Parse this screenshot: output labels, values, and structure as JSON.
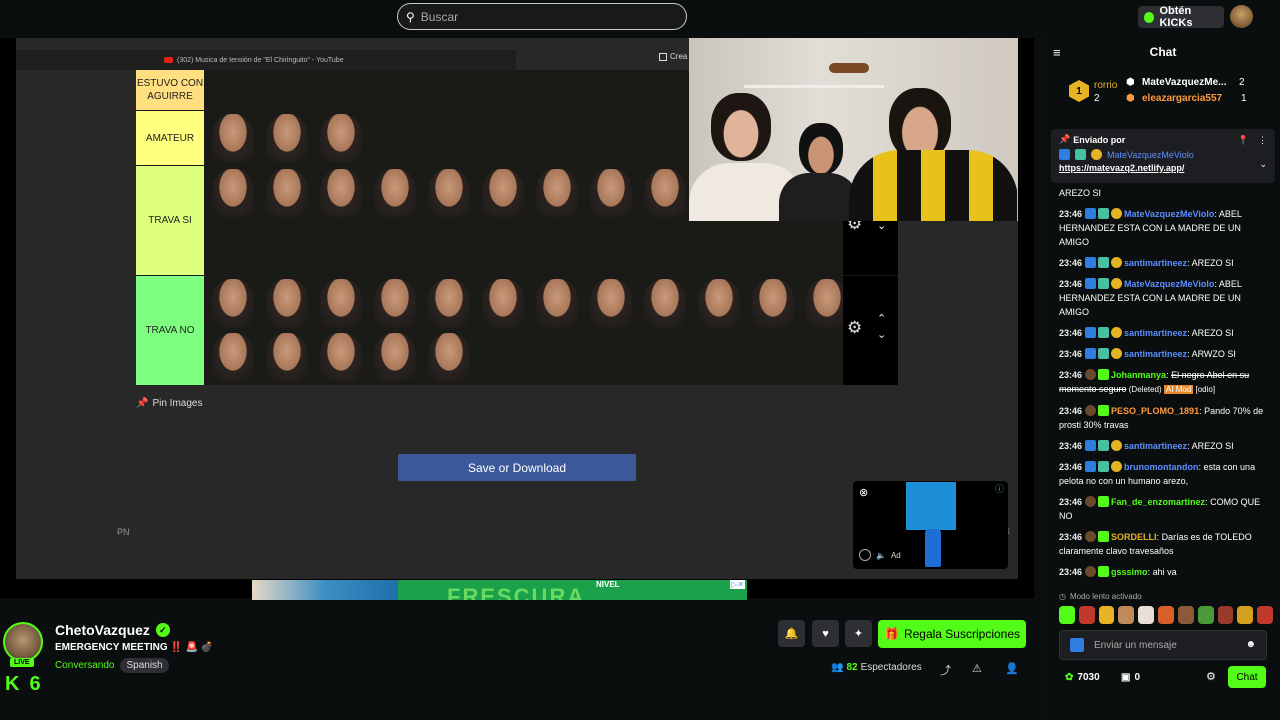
{
  "topbar": {
    "search_placeholder": "Buscar",
    "kicks_label": "Obtén KICKs"
  },
  "stream": {
    "yt_title": "(302) Musica de tensión de \"El Chiringuito\" - YouTube",
    "crea_label": "Crea",
    "tiers": [
      {
        "label": "ESTUVO CON AGUIRRE",
        "color": "#ffdf7f",
        "faces": 0
      },
      {
        "label": "AMATEUR",
        "color": "#ffff7f",
        "faces": 3
      },
      {
        "label": "TRAVA SI",
        "color": "#dfff7f",
        "faces": 10
      },
      {
        "label": "TRAVA NO",
        "color": "#7fff7f",
        "faces": 17
      }
    ],
    "pin_images": "Pin Images",
    "save_button": "Save or Download",
    "pn_left": "PN",
    "pn_right": "N",
    "ad_label": "Ad",
    "banner_text": "FRESCURA",
    "banner_brand": "NIVEL"
  },
  "channel": {
    "name": "ChetoVazquez",
    "live": "LIVE",
    "k_count": "6",
    "title": "EMERGENCY MEETING ‼️ 🚨 💣",
    "category": "Conversando",
    "language": "Spanish",
    "subscribe_button": "Regala Suscripciones",
    "viewers_count": "82",
    "viewers_label": "Espectadores"
  },
  "chat": {
    "title": "Chat",
    "leaderboard": {
      "top_badge": "1",
      "top_name": "rorrio",
      "top_count": "2",
      "second_name": "MateVazquezMe...",
      "second_count": "2",
      "third_name": "eleazargarcia557",
      "third_count": "1"
    },
    "pinned": {
      "header": "Enviado por",
      "user": "MateVazquezMeViolo",
      "url": "https://matevazq2.netlify.app/"
    },
    "messages": [
      {
        "ts": "",
        "user": "",
        "user_class": "",
        "text": "AREZO SI"
      },
      {
        "ts": "23:46",
        "user": "MateVazquezMeViolo",
        "user_class": "u-blue",
        "text": "ABEL HERNANDEZ ESTA CON LA MADRE DE UN AMIGO"
      },
      {
        "ts": "23:46",
        "user": "santimartineez",
        "user_class": "u-blue",
        "text": "AREZO SI"
      },
      {
        "ts": "23:46",
        "user": "MateVazquezMeViolo",
        "user_class": "u-blue",
        "text": "ABEL HERNANDEZ ESTA CON LA MADRE DE UN AMIGO"
      },
      {
        "ts": "23:46",
        "user": "santimartineez",
        "user_class": "u-blue",
        "text": "AREZO SI"
      },
      {
        "ts": "23:46",
        "user": "santimartineez",
        "user_class": "u-blue",
        "text": "ARWZO SI"
      },
      {
        "ts": "23:46",
        "user": "Johanmanya",
        "user_class": "u-green",
        "text": "El negro Abel en su momento seguro",
        "deleted": "(Deleted)",
        "aimod": "AI Mod",
        "tag": "[odio]"
      },
      {
        "ts": "23:46",
        "user": "PESO_PLOMO_1891",
        "user_class": "u-orange",
        "text": "Pando 70% de prosti 30% travas"
      },
      {
        "ts": "23:46",
        "user": "santimartineez",
        "user_class": "u-blue",
        "text": "AREZO SI"
      },
      {
        "ts": "23:46",
        "user": "brunomontandon",
        "user_class": "u-blue",
        "text": "esta con una pelota no con un humano arezo,"
      },
      {
        "ts": "23:46",
        "user": "Fan_de_enzomartinez",
        "user_class": "u-green",
        "text": "COMO QUE NO"
      },
      {
        "ts": "23:46",
        "user": "SORDELLI",
        "user_class": "u-yellow",
        "text": "Darías es de TOLEDO claramente clavo travesaños"
      },
      {
        "ts": "23:46",
        "user": "gsssimo",
        "user_class": "u-green",
        "text": "ahi va"
      }
    ],
    "slow_mode": "Modo lento activado",
    "input_placeholder": "Enviar un mensaje",
    "points": "7030",
    "other_points": "0",
    "chat_button": "Chat"
  }
}
